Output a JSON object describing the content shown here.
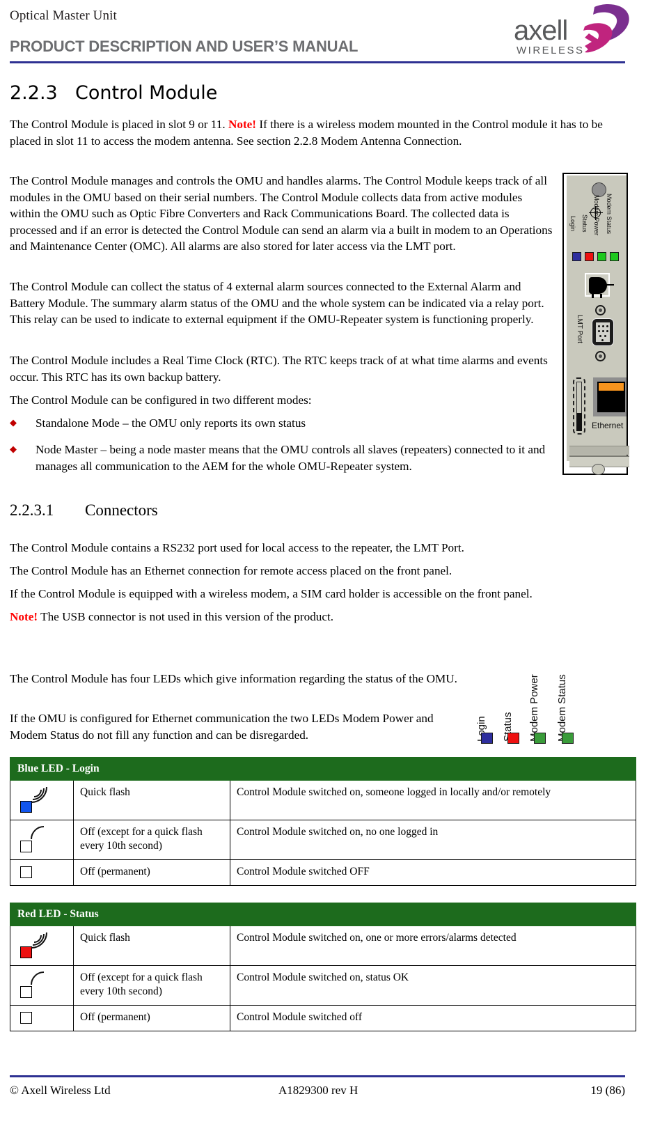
{
  "header": {
    "product_line": "Optical Master Unit",
    "doc_title": "PRODUCT DESCRIPTION AND USER’S MANUAL",
    "logo_text": "axell",
    "logo_subtext": "WIRELESS",
    "rule_color": "#2e3192"
  },
  "section": {
    "number": "2.2.3",
    "title": "Control Module",
    "sub_number": "2.2.3.1",
    "sub_title": "Connectors"
  },
  "body": {
    "p1_a": "The Control Module is placed in slot 9 or 11. ",
    "p1_note": "Note!",
    "p1_b": " If there is a wireless modem mounted in the Control module it has to be placed in slot 11 to access the modem antenna. See section 2.2.8 Modem Antenna Connection.",
    "p2": "The Control Module manages and controls the OMU and handles alarms. The Control Module keeps track of all modules in the OMU based on their serial numbers. The Control Module collects data from active modules within the OMU such as Optic Fibre Converters and Rack Communications Board. The collected data is processed and if an error is detected the Control Module can send an alarm via a built in modem to an Operations and Maintenance Center (OMC). All alarms are also stored for later access via the LMT port.",
    "p3": "The Control Module can collect the status of 4 external alarm sources connected to the External Alarm and Battery Module. The summary alarm status of the OMU and the whole system can be indicated via a relay port. This relay can be used to indicate to external equipment if the OMU-Repeater system is functioning properly.",
    "p4": "The Control Module includes a Real Time Clock (RTC). The RTC keeps track of at what time alarms and events occur. This RTC has its own backup battery.",
    "p5": "The Control Module can be configured in two different modes:",
    "bullets": [
      "Standalone Mode – the OMU only reports its own status",
      "Node Master – being a node master means that the OMU controls all slaves (repeaters) connected to it and manages all communication to the AEM for the whole OMU-Repeater system."
    ],
    "p6": "The Control Module contains a RS232 port used for local access to the repeater, the LMT Port.",
    "p7": "The Control Module has an Ethernet connection for remote access placed on the front panel.",
    "p8": "If the Control Module is equipped with a wireless modem, a SIM card holder is accessible on the front panel.",
    "p9_note": "Note!",
    "p9_text": " The USB connector is not used in this version of the product.",
    "p10": "The Control Module has four LEDs which give information regarding the status of the OMU.",
    "p11": "If the OMU is configured for Ethernet communication the two LEDs Modem Power and Modem Status do not fill any function and can be disregarded."
  },
  "module_panel": {
    "led_labels": [
      "Login",
      "Status",
      "Modem Power",
      "Modem Status"
    ],
    "led_colors": [
      "#2e2e9e",
      "#ee1111",
      "#1ec81e",
      "#1ec81e"
    ],
    "lmt_port_label": "LMT Port",
    "ethernet_label": "Ethernet"
  },
  "led_legend": {
    "labels": [
      "Login",
      "Status",
      "Modem Power",
      "Modem Status"
    ],
    "colors": [
      "#2e2e9e",
      "#ee1111",
      "#3a9c3a",
      "#3a9c3a"
    ]
  },
  "tables": [
    {
      "header": "Blue LED - Login",
      "header_bg": "#1d6b1d",
      "led_color": "#1155ee",
      "rows": [
        {
          "icon": "led-quick-flash",
          "state": "Quick flash",
          "description": "Control Module switched on, someone logged in locally and/or remotely"
        },
        {
          "icon": "led-off-with-flash",
          "state": "Off (except for a quick flash every 10th second)",
          "description": "Control Module switched on, no one logged in"
        },
        {
          "icon": "led-off",
          "state": "Off  (permanent)",
          "description": "Control Module switched OFF"
        }
      ]
    },
    {
      "header": "Red LED - Status",
      "header_bg": "#1d6b1d",
      "led_color": "#ee1111",
      "rows": [
        {
          "icon": "led-quick-flash",
          "state": "Quick flash",
          "description": "Control Module switched on, one or more errors/alarms detected"
        },
        {
          "icon": "led-off-with-flash",
          "state": "Off (except for a quick flash every 10th second)",
          "description": "Control Module switched on, status OK"
        },
        {
          "icon": "led-off",
          "state": "Off  (permanent)",
          "description": "Control Module switched off"
        }
      ]
    }
  ],
  "footer": {
    "copyright": "© Axell Wireless Ltd",
    "doc_number": "A1829300 rev H",
    "page": "19 (86)"
  }
}
